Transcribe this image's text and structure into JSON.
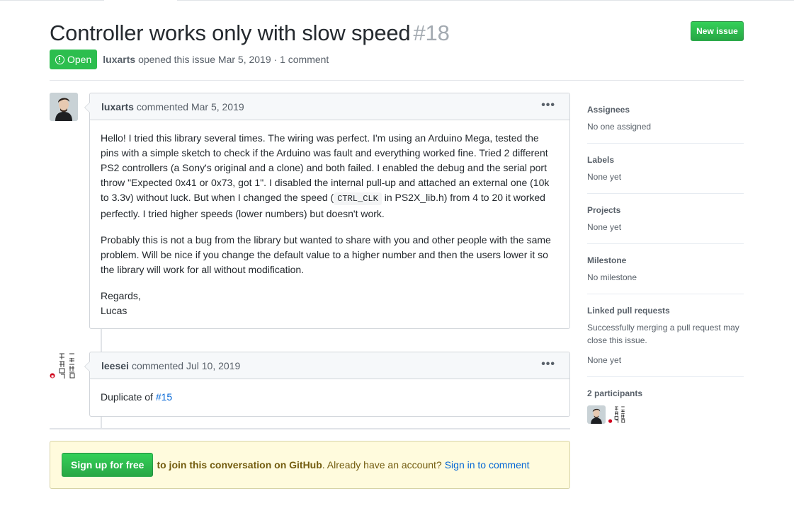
{
  "issue": {
    "title": "Controller works only with slow speed",
    "number": "#18",
    "state": "Open",
    "author": "luxarts",
    "meta_text": "opened this issue Mar 5, 2019 · 1 comment",
    "new_issue_label": "New issue"
  },
  "comments": [
    {
      "author": "luxarts",
      "action": "commented Mar 5, 2019",
      "menu": "•••",
      "paragraphs": {
        "p1_before_code": "Hello! I tried this library several times. The wiring was perfect. I'm using an Arduino Mega, tested the pins with a simple sketch to check if the Arduino was fault and everything worked fine. Tried 2 different PS2 controllers (a Sony's original and a clone) and both failed. I enabled the debug and the serial port throw \"Expected 0x41 or 0x73, got 1\". I disabled the internal pull-up and attached an external one (10k to 3.3v) without luck. But when I changed the speed (",
        "p1_code": "CTRL_CLK",
        "p1_after_code": " in PS2X_lib.h) from 4 to 20 it worked perfectly. I tried higher speeds (lower numbers) but doesn't work.",
        "p2": "Probably this is not a bug from the library but wanted to share with you and other people with the same problem. Will be nice if you change the default value to a higher number and then the users lower it so the library will work for all without modification.",
        "p3_line1": "Regards,",
        "p3_line2": "Lucas"
      }
    },
    {
      "author": "leesei",
      "action": "commented Jul 10, 2019",
      "menu": "•••",
      "body_prefix": "Duplicate of ",
      "body_link": "#15"
    }
  ],
  "signup": {
    "button": "Sign up for free",
    "join_text": "to join this conversation on GitHub",
    "already_text": ". Already have an account?",
    "signin_link": "Sign in to comment"
  },
  "sidebar": {
    "assignees": {
      "heading": "Assignees",
      "value": "No one assigned"
    },
    "labels": {
      "heading": "Labels",
      "value": "None yet"
    },
    "projects": {
      "heading": "Projects",
      "value": "None yet"
    },
    "milestone": {
      "heading": "Milestone",
      "value": "No milestone"
    },
    "linked_prs": {
      "heading": "Linked pull requests",
      "description": "Successfully merging a pull request may close this issue.",
      "value": "None yet"
    },
    "participants": {
      "heading": "2 participants"
    }
  },
  "colors": {
    "open_green": "#2cbe4e",
    "button_green": "#28a745",
    "link_blue": "#0366d6",
    "signup_bg": "#fffbdd"
  }
}
